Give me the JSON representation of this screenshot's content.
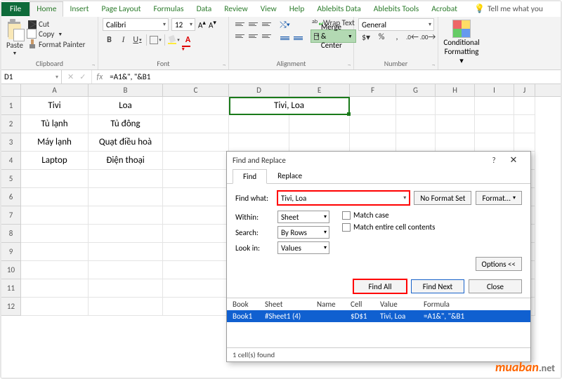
{
  "menus": {
    "file": "File",
    "home": "Home",
    "insert": "Insert",
    "page_layout": "Page Layout",
    "formulas": "Formulas",
    "data": "Data",
    "review": "Review",
    "view": "View",
    "help": "Help",
    "ablebits_data": "Ablebits Data",
    "ablebits_tools": "Ablebits Tools",
    "acrobat": "Acrobat",
    "tellme": "Tell me what you"
  },
  "ribbon": {
    "paste": "Paste",
    "cut": "Cut",
    "copy": "Copy",
    "format_painter": "Format Painter",
    "clipboard": "Clipboard",
    "font_name": "Calibri",
    "font_size": "12",
    "font_group": "Font",
    "wrap": "Wrap Text",
    "merge": "Merge & Center",
    "alignment": "Alignment",
    "num_fmt": "General",
    "number": "Number",
    "cf": "Conditional",
    "cf2": "Formatting"
  },
  "fbar": {
    "name": "D1",
    "fx": "fx",
    "formula": "=A1&\", \"&B1",
    "x": "✕",
    "chk": "✓"
  },
  "cols": [
    "A",
    "B",
    "C",
    "D",
    "E",
    "F",
    "G",
    "H",
    "I",
    "J"
  ],
  "rows": [
    "1",
    "2",
    "3",
    "4",
    "5",
    "6",
    "7",
    "8",
    "9",
    "10",
    "11",
    "12"
  ],
  "cells": {
    "A1": "Tivi",
    "B1": "Loa",
    "D1": "Tivi, Loa",
    "A2": "Tủ lạnh",
    "B2": "Tủ đông",
    "A3": "Máy lạnh",
    "B3": "Quạt điều hoà",
    "A4": "Laptop",
    "B4": "Điện thoại"
  },
  "dialog": {
    "title": "Find and Replace",
    "tab_find": "Find",
    "tab_replace": "Replace",
    "find_what_lbl": "Find what:",
    "find_what_val": "Tivi, Loa",
    "no_format": "No Format Set",
    "format": "Format...",
    "within_lbl": "Within:",
    "within_val": "Sheet",
    "search_lbl": "Search:",
    "search_val": "By Rows",
    "lookin_lbl": "Look in:",
    "lookin_val": "Values",
    "match_case": "Match case",
    "match_entire": "Match entire cell contents",
    "options": "Options <<",
    "find_all": "Find All",
    "find_next": "Find Next",
    "close": "Close",
    "h_book": "Book",
    "h_sheet": "Sheet",
    "h_name": "Name",
    "h_cell": "Cell",
    "h_value": "Value",
    "h_formula": "Formula",
    "r_book": "Book1",
    "r_sheet": "#Sheet1 (4)",
    "r_name": "",
    "r_cell": "$D$1",
    "r_value": "Tivi, Loa",
    "r_formula": "=A1&\", \"&B1",
    "status": "1 cell(s) found"
  },
  "watermark": {
    "a": "muaban",
    "b": ".net"
  }
}
